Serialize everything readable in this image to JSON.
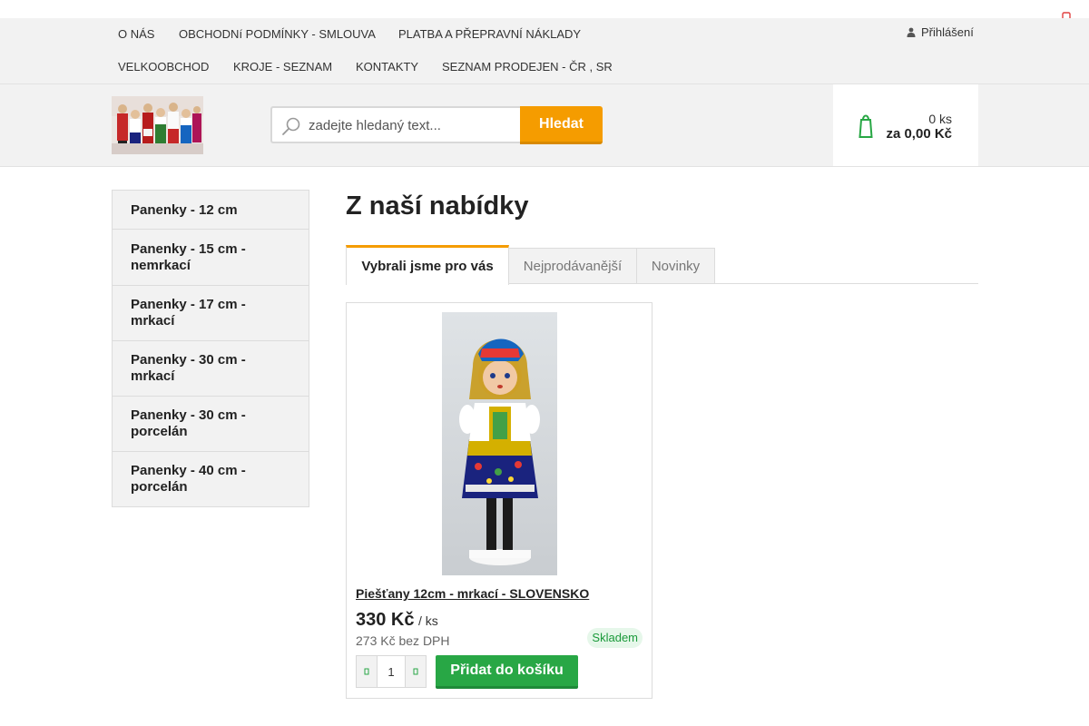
{
  "nav": {
    "row1": [
      "O NÁS",
      "OBCHODNí PODMÍNKY - SMLOUVA",
      "PLATBA A PŘEPRAVNÍ NÁKLADY"
    ],
    "row2": [
      "VELKOOBCHOD",
      "KROJE - SEZNAM",
      "KONTAKTY",
      "SEZNAM PRODEJEN - ČR , SR"
    ],
    "login_label": "Přihlášení",
    "login_icon": "user-icon"
  },
  "header": {
    "logo_icon": "dolls-logo",
    "search": {
      "placeholder": "zadejte hledaný text...",
      "value": "",
      "button_label": "Hledat",
      "icon": "search-icon"
    },
    "cart": {
      "icon": "cart-icon",
      "count": "0 ks",
      "total": "za 0,00 Kč"
    }
  },
  "sidebar": {
    "items": [
      "Panenky - 12 cm",
      "Panenky - 15 cm - nemrkací",
      "Panenky - 17 cm - mrkací",
      "Panenky - 30 cm - mrkací",
      "Panenky - 30 cm - porcelán",
      "Panenky - 40 cm - porcelán"
    ]
  },
  "main": {
    "title": "Z naší nabídky",
    "tabs": [
      {
        "label": "Vybrali jsme pro vás",
        "active": true
      },
      {
        "label": "Nejprodávanější",
        "active": false
      },
      {
        "label": "Novinky",
        "active": false
      }
    ],
    "product": {
      "name": "Piešťany 12cm - mrkací - SLOVENSKO",
      "price": "330 Kč",
      "unit": "/ ks",
      "price_novat": "273 Kč bez DPH",
      "stock": "Skladem",
      "quantity": "1",
      "add_label": "Přidat do košíku"
    }
  },
  "colors": {
    "accent_orange": "#f59c00",
    "cart_green": "#28a745",
    "stock_green": "#1a9a3a"
  }
}
